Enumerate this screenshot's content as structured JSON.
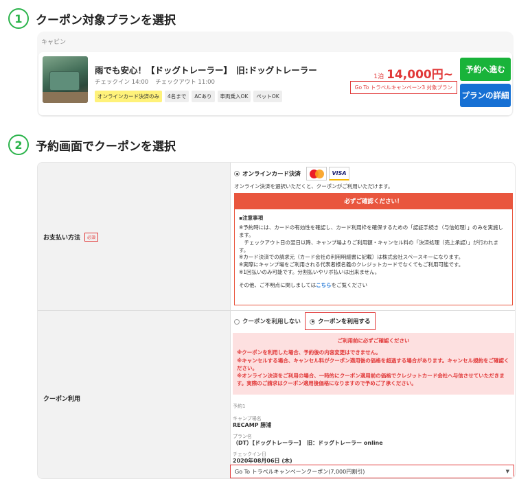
{
  "step1": {
    "number": "1",
    "title": "クーポン対象プランを選択"
  },
  "plan": {
    "category": "キャビン",
    "name": "雨でも安心！【ドッグトレーラー】　旧:ドッグトレーラー",
    "checkin": "チェックイン 14:00",
    "checkout": "チェックアウト 11:00",
    "tags": [
      "オンラインカード決済のみ",
      "4名まで",
      "ACあり",
      "車両乗入OK",
      "ペットOK"
    ],
    "price_unit": "1泊",
    "price": "14,000円~",
    "campaign_label": "Go To トラベルキャンペーン3 対象プラン",
    "reserve_button": "予約へ進む",
    "detail_button": "プランの詳細"
  },
  "step2": {
    "number": "2",
    "title": "予約画面でクーポンを選択"
  },
  "payment": {
    "label": "お支払い方法",
    "required": "必須",
    "option": "オンラインカード決済",
    "visa": "VISA",
    "note": "オンライン決済を選択いただくと、クーポンがご利用いただけます。",
    "warn_header": "必ずご確認ください！",
    "warn_title": "▪注意事項",
    "warn_lines": [
      "※予約時には、カードの有効性を確認し、カード利用枠を確保するための「認証手続き（与信処理）」のみを実施します。",
      "　チェックアウト日の翌日以降、キャンプ場よりご利用額・キャンセル料の「決済処理（売上承認）」が行われます。",
      "※カード決済での請求元（カード会社の利用明細書に記載）は株式会社スペースキーになります。",
      "※実際にキャンプ場をご利用される代表者様名義のクレジットカードでなくてもご利用可能です。",
      "※1回払いのみ可能です。分割払いやリボ払いは出来ません。"
    ],
    "contact_pre": "その他、ご不明点に関しましては",
    "contact_link": "こちら",
    "contact_post": "をご覧ください"
  },
  "coupon": {
    "label": "クーポン利用",
    "option_no": "クーポンを利用しない",
    "option_yes": "クーポンを利用する",
    "notice_title": "ご利用前に必ずご確認ください",
    "notice_lines": [
      "※クーポンを利用した場合、予約後の内容変更はできません。",
      "※キャンセルする場合、キャンセル料がクーポン適用後の価格を超過する場合があります。キャンセル規約をご確認ください。",
      "※オンライン決済をご利用の場合、一時的にクーポン適用前の価格でクレジットカード会社へ与信させていただきます。実際のご請求はクーポン適用後価格になりますので予めご了承ください。"
    ],
    "reservation_heading": "予約1",
    "campsite_label": "キャンプ場名",
    "campsite_value": "RECAMP 勝浦",
    "plan_label": "プラン名",
    "plan_value": "（DT）【ドッグトレーラー】　旧：ドッグトレーラー online",
    "checkin_label": "チェックイン日",
    "checkin_value": "2020年08月06日 (木)",
    "selected_coupon": "Go To トラベルキャンペーンクーポン(7,000円割引)"
  }
}
